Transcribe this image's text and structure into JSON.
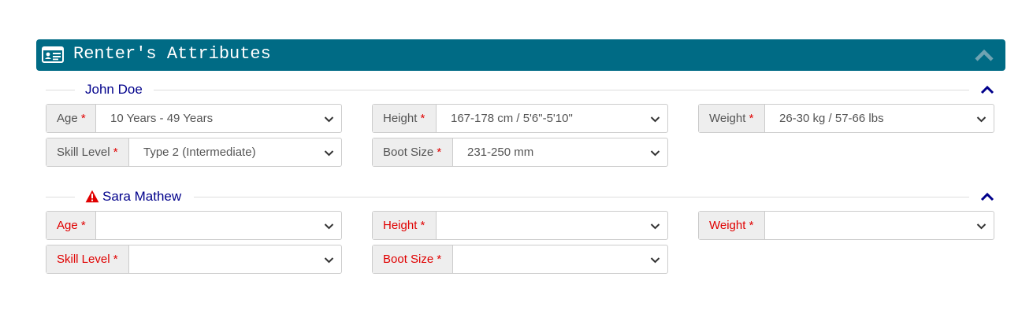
{
  "panel": {
    "title": "Renter's Attributes"
  },
  "renters": [
    {
      "name": "John Doe",
      "has_warning": false,
      "fields": {
        "age": {
          "label": "Age",
          "required": "*",
          "value": "10 Years - 49 Years"
        },
        "height": {
          "label": "Height",
          "required": "*",
          "value": "167-178 cm / 5'6\"-5'10\""
        },
        "weight": {
          "label": "Weight",
          "required": "*",
          "value": "26-30 kg / 57-66 lbs"
        },
        "skill": {
          "label": "Skill Level",
          "required": "*",
          "value": "Type 2 (Intermediate)"
        },
        "boot": {
          "label": "Boot Size",
          "required": "*",
          "value": "231-250 mm"
        }
      }
    },
    {
      "name": "Sara Mathew",
      "has_warning": true,
      "fields": {
        "age": {
          "label": "Age",
          "required": "*",
          "value": ""
        },
        "height": {
          "label": "Height",
          "required": "*",
          "value": ""
        },
        "weight": {
          "label": "Weight",
          "required": "*",
          "value": ""
        },
        "skill": {
          "label": "Skill Level",
          "required": "*",
          "value": ""
        },
        "boot": {
          "label": "Boot Size",
          "required": "*",
          "value": ""
        }
      }
    }
  ],
  "colors": {
    "header_bg": "#006b85",
    "name_color": "#00008b",
    "required_color": "#e00000",
    "warning_color": "#e00000"
  },
  "icons": {
    "header": "id-card-icon",
    "collapse": "chevron-up-icon",
    "warning": "warning-triangle-icon",
    "select": "chevron-down-icon"
  }
}
